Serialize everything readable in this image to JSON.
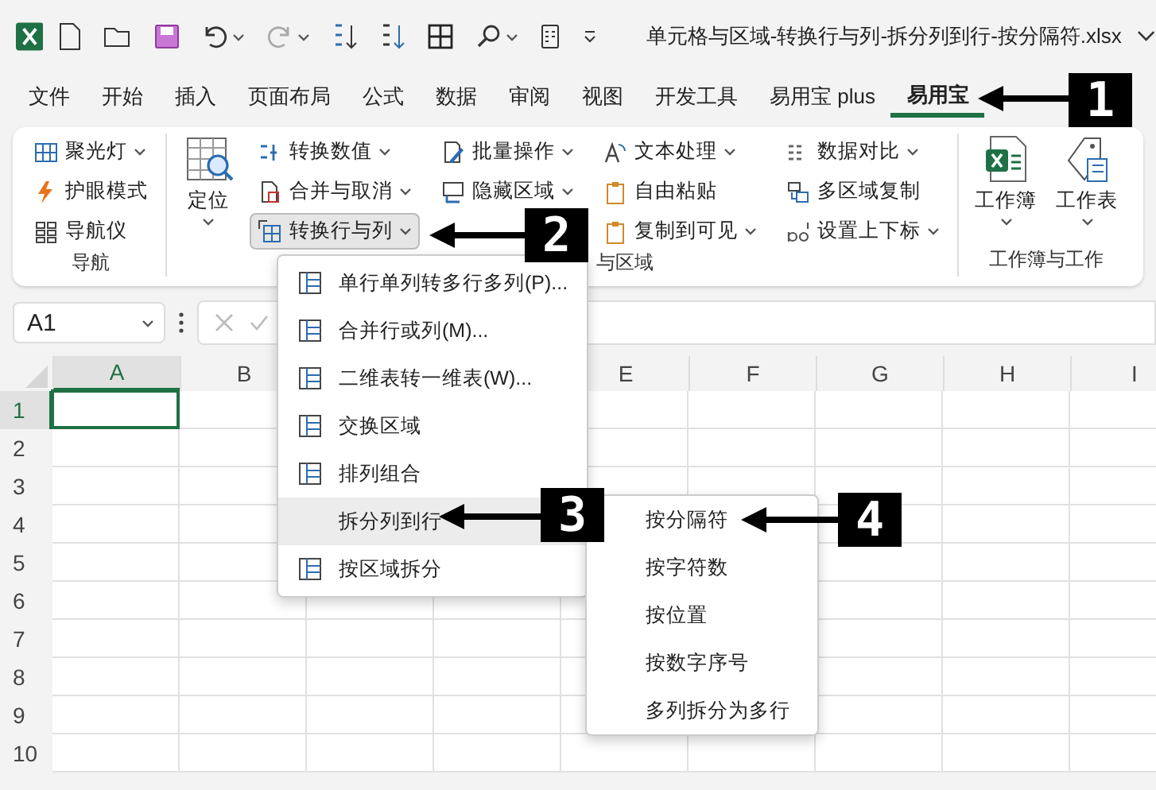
{
  "title_bar": {
    "file_name": "单元格与区域-转换行与列-拆分列到行-按分隔符.xlsx"
  },
  "tabs": [
    {
      "label": "文件",
      "selected": false
    },
    {
      "label": "开始",
      "selected": false
    },
    {
      "label": "插入",
      "selected": false
    },
    {
      "label": "页面布局",
      "selected": false
    },
    {
      "label": "公式",
      "selected": false
    },
    {
      "label": "数据",
      "selected": false
    },
    {
      "label": "审阅",
      "selected": false
    },
    {
      "label": "视图",
      "selected": false
    },
    {
      "label": "开发工具",
      "selected": false
    },
    {
      "label": "易用宝 plus",
      "selected": false
    },
    {
      "label": "易用宝",
      "selected": true
    }
  ],
  "ribbon": {
    "groups": [
      {
        "label": "导航",
        "columns": [
          {
            "kind": "stack",
            "items": [
              {
                "label": "聚光灯",
                "dropdown": true,
                "pressed": false
              },
              {
                "label": "护眼模式",
                "dropdown": false,
                "pressed": false
              },
              {
                "label": "导航仪",
                "dropdown": false,
                "pressed": false
              }
            ]
          }
        ]
      },
      {
        "label": "与区域",
        "columns": [
          {
            "kind": "large",
            "label": "定位",
            "dropdown": true
          },
          {
            "kind": "stack",
            "items": [
              {
                "label": "转换数值",
                "dropdown": true,
                "pressed": false
              },
              {
                "label": "合并与取消",
                "dropdown": true,
                "pressed": false
              },
              {
                "label": "转换行与列",
                "dropdown": true,
                "pressed": true
              }
            ]
          },
          {
            "kind": "stack",
            "items": [
              {
                "label": "批量操作",
                "dropdown": true,
                "pressed": false
              },
              {
                "label": "隐藏区域",
                "dropdown": true,
                "pressed": false
              }
            ]
          },
          {
            "kind": "stack",
            "items": [
              {
                "label": "文本处理",
                "dropdown": true,
                "pressed": false
              },
              {
                "label": "自由粘贴",
                "dropdown": false,
                "pressed": false
              },
              {
                "label": "复制到可见",
                "dropdown": true,
                "pressed": false
              }
            ]
          },
          {
            "kind": "stack",
            "items": [
              {
                "label": "数据对比",
                "dropdown": true,
                "pressed": false
              },
              {
                "label": "多区域复制",
                "dropdown": false,
                "pressed": false
              },
              {
                "label": "设置上下标",
                "dropdown": true,
                "pressed": false
              }
            ]
          }
        ]
      },
      {
        "label": "工作簿与工作",
        "columns": [
          {
            "kind": "large",
            "label": "工作簿",
            "dropdown": true
          },
          {
            "kind": "large",
            "label": "工作表",
            "dropdown": true
          }
        ]
      }
    ]
  },
  "formula_bar": {
    "name_box": "A1"
  },
  "sheet": {
    "columns": [
      {
        "label": "A",
        "selected": true
      },
      {
        "label": "B",
        "selected": false
      },
      {},
      {},
      {
        "label": "E",
        "selected": false
      },
      {
        "label": "F",
        "selected": false
      },
      {
        "label": "G",
        "selected": false
      },
      {
        "label": "H",
        "selected": false
      },
      {
        "label": "I",
        "selected": false
      }
    ],
    "rows": [
      {
        "label": "1",
        "selected": true
      },
      {
        "label": "2",
        "selected": false
      },
      {
        "label": "3",
        "selected": false
      },
      {
        "label": "4",
        "selected": false
      },
      {
        "label": "5",
        "selected": false
      },
      {
        "label": "6",
        "selected": false
      },
      {
        "label": "7",
        "selected": false
      },
      {
        "label": "8",
        "selected": false
      },
      {
        "label": "9",
        "selected": false
      },
      {
        "label": "10",
        "selected": false
      }
    ]
  },
  "dropdown_menu": {
    "items": [
      {
        "label": "单行单列转多行多列(P)...",
        "kind": "icon",
        "selected": false
      },
      {
        "label": "合并行或列(M)...",
        "kind": "icon",
        "selected": false
      },
      {
        "label": "二维表转一维表(W)...",
        "kind": "icon",
        "selected": false
      },
      {
        "label": "交换区域",
        "kind": "icon",
        "selected": false
      },
      {
        "label": "排列组合",
        "kind": "icon",
        "selected": false
      },
      {
        "label": "拆分列到行",
        "kind": "plain",
        "selected": true
      },
      {
        "label": "按区域拆分",
        "kind": "icon",
        "selected": false
      }
    ]
  },
  "submenu": {
    "items": [
      {
        "label": "按分隔符"
      },
      {
        "label": "按字符数"
      },
      {
        "label": "按位置"
      },
      {
        "label": "按数字序号"
      },
      {
        "label": "多列拆分为多行"
      }
    ]
  },
  "callouts": [
    {
      "number": "1"
    },
    {
      "number": "2"
    },
    {
      "number": "3"
    },
    {
      "number": "4"
    }
  ]
}
